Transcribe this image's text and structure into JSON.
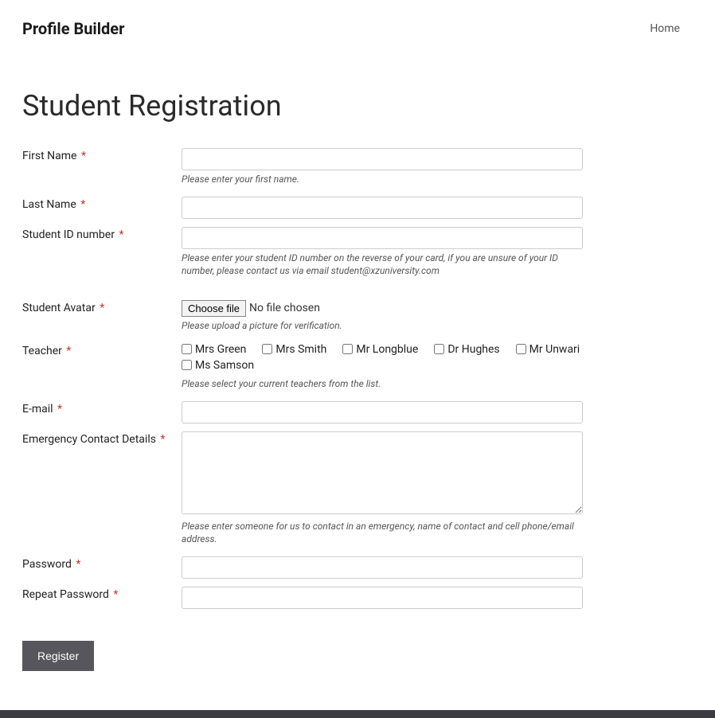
{
  "header": {
    "site_title": "Profile Builder",
    "nav_home": "Home"
  },
  "page": {
    "title": "Student Registration"
  },
  "form": {
    "first_name": {
      "label": "First Name",
      "help": "Please enter your first name."
    },
    "last_name": {
      "label": "Last Name"
    },
    "student_id": {
      "label": "Student ID number",
      "help": "Please enter your student ID number on the reverse of your card, if you are unsure of your ID number, please contact us via email student@xzuniversity.com"
    },
    "avatar": {
      "label": "Student Avatar",
      "choose_btn": "Choose file",
      "status": "No file chosen",
      "help": "Please upload a picture for verification."
    },
    "teacher": {
      "label": "Teacher",
      "options": [
        "Mrs Green",
        "Mrs Smith",
        "Mr Longblue",
        "Dr Hughes",
        "Mr Unwari",
        "Ms Samson"
      ],
      "help": "Please select your current teachers from the list."
    },
    "email": {
      "label": "E-mail"
    },
    "emergency": {
      "label": "Emergency Contact Details",
      "help": "Please enter someone for us to contact in an emergency, name of contact and cell phone/email address."
    },
    "password": {
      "label": "Password"
    },
    "repeat_password": {
      "label": "Repeat Password"
    },
    "submit": "Register",
    "required_marker": "*"
  }
}
